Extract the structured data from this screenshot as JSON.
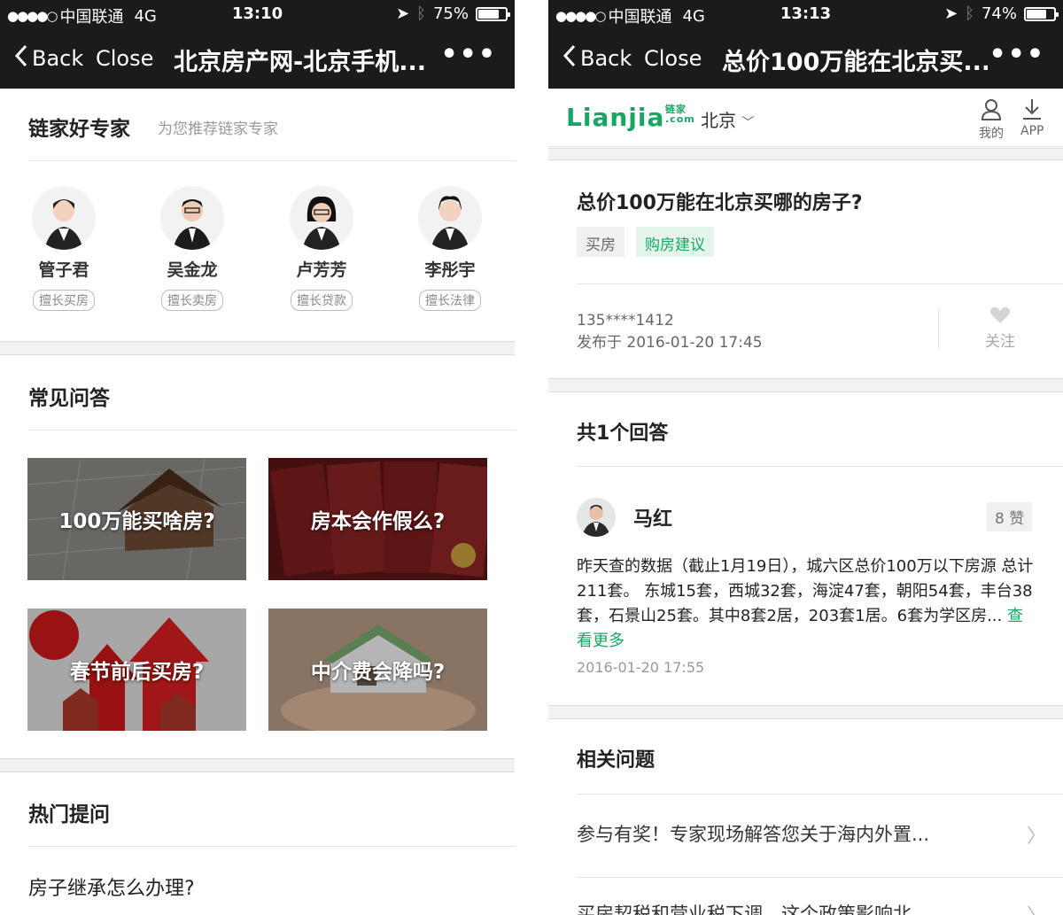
{
  "left": {
    "status": {
      "carrier": "中国联通",
      "network": "4G",
      "time": "13:10",
      "battery": "75%",
      "battery_level": 0.75
    },
    "nav": {
      "back": "Back",
      "close": "Close",
      "title": "北京房产网-北京手机...",
      "more": "•••"
    },
    "experts_section": {
      "title": "链家好专家",
      "subtitle": "为您推荐链家专家",
      "experts": [
        {
          "name": "管子君",
          "tag": "擅长买房"
        },
        {
          "name": "吴金龙",
          "tag": "擅长卖房"
        },
        {
          "name": "卢芳芳",
          "tag": "擅长贷款"
        },
        {
          "name": "李彤宇",
          "tag": "擅长法律"
        }
      ]
    },
    "faq": {
      "title": "常见问答",
      "tiles": [
        {
          "text": "100万能买啥房?"
        },
        {
          "text": "房本会作假么?"
        },
        {
          "text": "春节前后买房?"
        },
        {
          "text": "中介费会降吗?"
        }
      ]
    },
    "hot": {
      "title": "热门提问",
      "first_question": "房子继承怎么办理?"
    }
  },
  "right": {
    "status": {
      "carrier": "中国联通",
      "network": "4G",
      "time": "13:13",
      "battery": "74%",
      "battery_level": 0.74
    },
    "nav": {
      "back": "Back",
      "close": "Close",
      "title": "总价100万能在北京买...",
      "more": "•••"
    },
    "header": {
      "logo": "Lianjia",
      "logo_cn": "链家",
      "logo_domain": ".com",
      "city": "北京",
      "mine_label": "我的",
      "app_label": "APP"
    },
    "question": {
      "title": "总价100万能在北京买哪的房子?",
      "tags": [
        "买房",
        "购房建议"
      ],
      "asker": "135****1412",
      "posted": "发布于 2016-01-20 17:45",
      "follow": "关注"
    },
    "answers": {
      "count_title": "共1个回答",
      "items": [
        {
          "author": "马红",
          "likes": "8 赞",
          "body": "昨天查的数据（截止1月19日），城六区总价100万以下房源 总计211套。 东城15套，西城32套，海淀47套，朝阳54套，丰台38套，石景山25套。其中8套2居，203套1居。6套为学区房...",
          "more": "查看更多",
          "time": "2016-01-20 17:55"
        }
      ]
    },
    "related": {
      "title": "相关问题",
      "items": [
        "参与有奖！专家现场解答您关于海内外置...",
        "买房契税和营业税下调，这个政策影响北..."
      ]
    },
    "colors": {
      "brand_green": "#1aa564"
    }
  }
}
